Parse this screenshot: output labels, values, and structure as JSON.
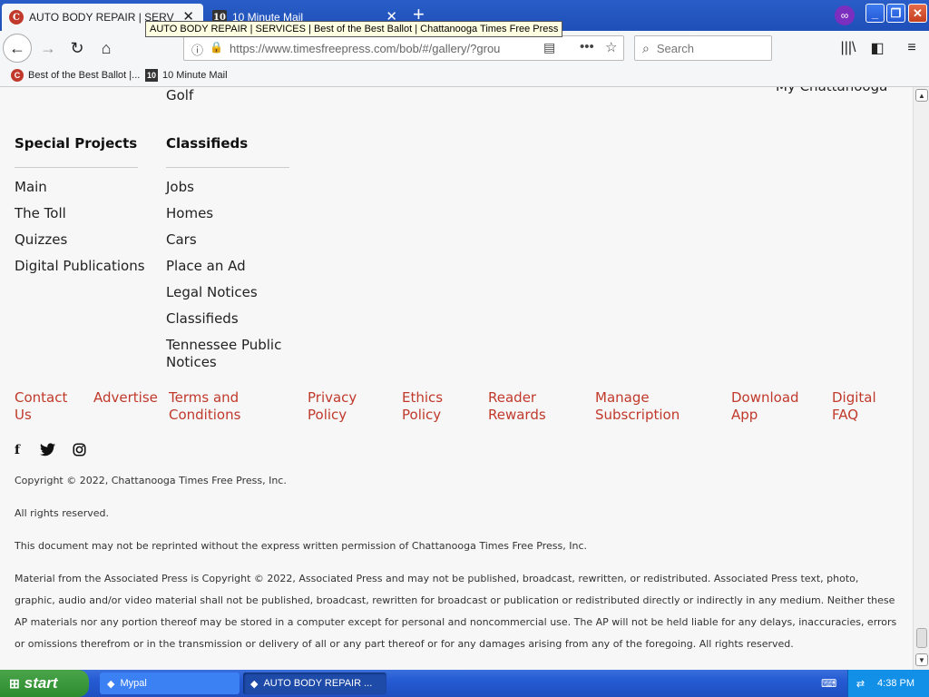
{
  "browser": {
    "tabs": [
      {
        "label": "AUTO BODY REPAIR | SERVICE",
        "icon": "C"
      },
      {
        "label": "10 Minute Mail",
        "icon": "10"
      }
    ],
    "tooltip": "AUTO BODY REPAIR | SERVICES | Best of the Best Ballot | Chattanooga Times Free Press",
    "url": "https://www.timesfreepress.com/bob/#/gallery/?grou",
    "search_placeholder": "Search",
    "bookmarks": [
      {
        "label": "Best of the Best Ballot |...",
        "icon": "C"
      },
      {
        "label": "10 Minute Mail",
        "icon": "10"
      }
    ]
  },
  "page": {
    "cut_top_left": "Golf",
    "cut_top_right": "My Chattanooga",
    "special_projects": {
      "heading": "Special Projects",
      "items": [
        "Main",
        "The Toll",
        "Quizzes",
        "Digital Publications"
      ]
    },
    "classifieds": {
      "heading": "Classifieds",
      "items": [
        "Jobs",
        "Homes",
        "Cars",
        "Place an Ad",
        "Legal Notices",
        "Classifieds",
        "Tennessee Public Notices"
      ]
    },
    "footer_links": [
      "Contact Us",
      "Advertise",
      "Terms and Conditions",
      "Privacy Policy",
      "Ethics Policy",
      "Reader Rewards",
      "Manage Subscription",
      "Download App",
      "Digital FAQ"
    ],
    "social": [
      "f",
      "t",
      "i"
    ],
    "copyright": "Copyright © 2022, Chattanooga Times Free Press, Inc.",
    "rights": "All rights reserved.",
    "reprint": "This document may not be reprinted without the express written permission of Chattanooga Times Free Press, Inc.",
    "ap_notice": "Material from the Associated Press is Copyright © 2022, Associated Press and may not be published, broadcast, rewritten, or redistributed. Associated Press text, photo, graphic, audio and/or video material shall not be published, broadcast, rewritten for broadcast or publication or redistributed directly or indirectly in any medium. Neither these AP materials nor any portion thereof may be stored in a computer except for personal and noncommercial use. The AP will not be held liable for any delays, inaccuracies, errors or omissions therefrom or in the transmission or delivery of all or any part thereof or for any damages arising from any of the foregoing. All rights reserved."
  },
  "taskbar": {
    "start": "start",
    "tasks": [
      "Mypal",
      "AUTO BODY REPAIR ..."
    ],
    "clock": "4:38 PM"
  },
  "colors": {
    "link_red": "#c0392b",
    "xp_blue": "#245ad3"
  }
}
